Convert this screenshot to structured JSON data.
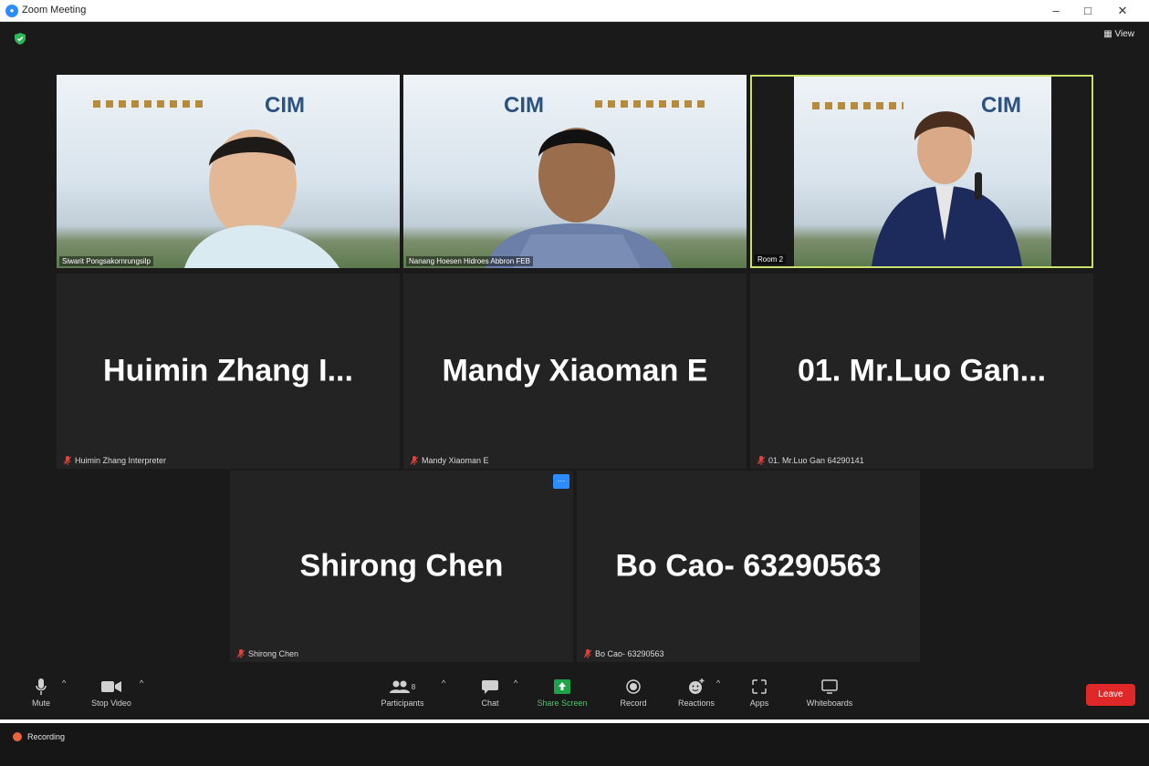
{
  "window": {
    "title": "Zoom Meeting",
    "controls": [
      "–",
      "□",
      "✕"
    ]
  },
  "header": {
    "view_label": "View"
  },
  "videos": [
    {
      "name": "Siwarit Pongsakornrungsilp",
      "banner": "CIM"
    },
    {
      "name": "Nanang Hoesen Hidroes Abbron FEB",
      "banner": "CIM"
    },
    {
      "name": "Room 2",
      "banner": "CIM"
    }
  ],
  "tiles": [
    {
      "display": "Huimin Zhang I...",
      "label": "Huimin Zhang Interpreter"
    },
    {
      "display": "Mandy Xiaoman E",
      "label": "Mandy Xiaoman E"
    },
    {
      "display": "01. Mr.Luo Gan...",
      "label": "01. Mr.Luo Gan 64290141"
    },
    {
      "display": "Shirong Chen",
      "label": "Shirong Chen"
    },
    {
      "display": "Bo Cao- 63290563",
      "label": "Bo Cao- 63290563"
    }
  ],
  "toolbar": {
    "mute": "Mute",
    "stop_video": "Stop Video",
    "participants": "Participants",
    "participants_count": "8",
    "chat": "Chat",
    "share_screen": "Share Screen",
    "record": "Record",
    "reactions": "Reactions",
    "apps": "Apps",
    "whiteboards": "Whiteboards",
    "leave": "Leave"
  },
  "recording": {
    "label": "Recording"
  },
  "colors": {
    "accent_blue": "#2d8cff",
    "active_speaker": "#c9e06a",
    "leave_red": "#e02828",
    "share_green": "#4cc66e",
    "muted_red": "#e0433c"
  }
}
